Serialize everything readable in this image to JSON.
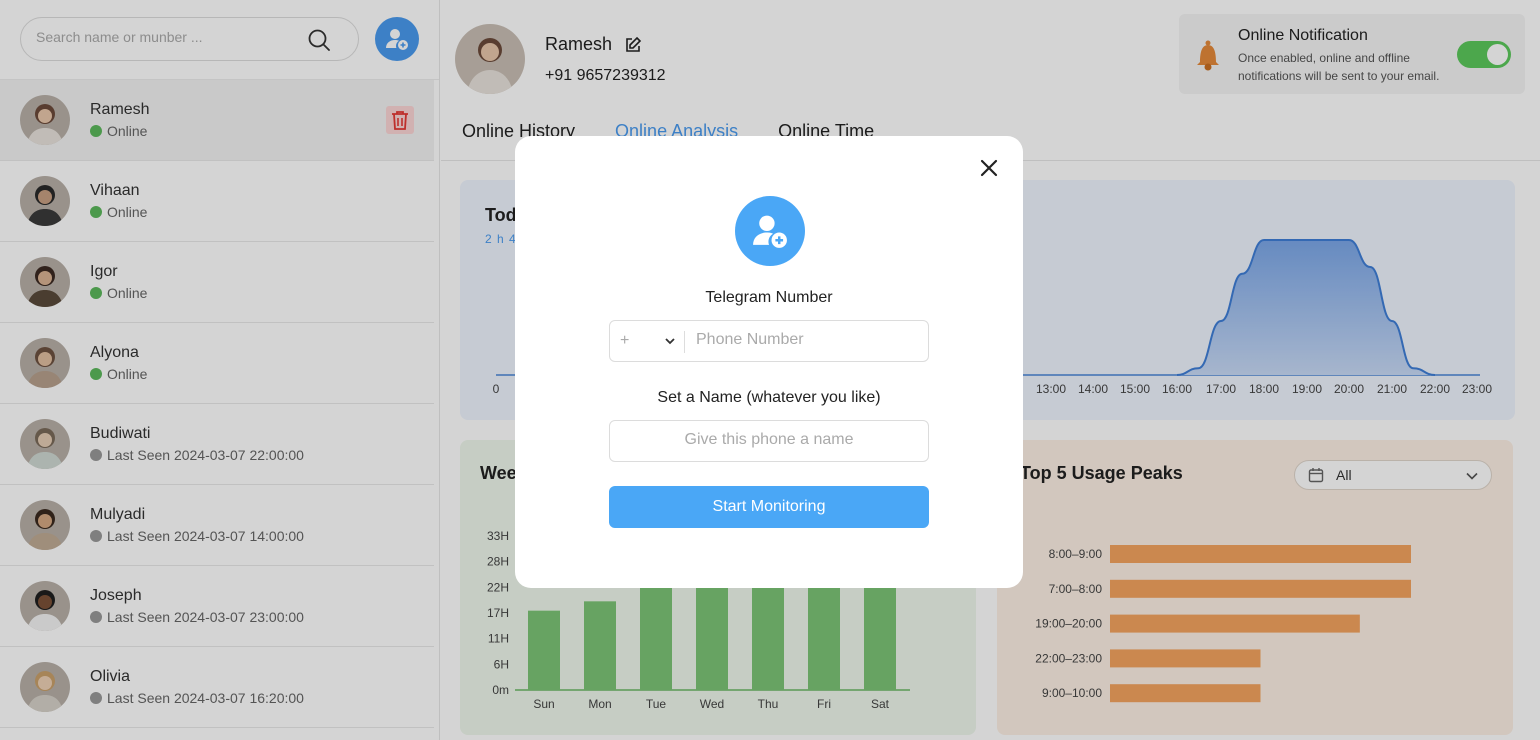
{
  "search": {
    "placeholder": "Search name or munber ..."
  },
  "contacts": [
    {
      "name": "Ramesh",
      "status": "Online",
      "online": true
    },
    {
      "name": "Vihaan",
      "status": "Online",
      "online": true
    },
    {
      "name": "Igor",
      "status": "Online",
      "online": true
    },
    {
      "name": "Alyona",
      "status": "Online",
      "online": true
    },
    {
      "name": "Budiwati",
      "status": "Last Seen 2024-03-07 22:00:00",
      "online": false
    },
    {
      "name": "Mulyadi",
      "status": "Last Seen 2024-03-07 14:00:00",
      "online": false
    },
    {
      "name": "Joseph",
      "status": "Last Seen 2024-03-07 23:00:00",
      "online": false
    },
    {
      "name": "Olivia",
      "status": "Last Seen 2024-03-07 16:20:00",
      "online": false
    }
  ],
  "profile": {
    "name": "Ramesh",
    "phone": "+91 9657239312"
  },
  "notification": {
    "title": "Online Notification",
    "description": "Once enabled, online and offline notifications will be sent to your email.",
    "enabled": true
  },
  "tabs": [
    {
      "label": "Online History"
    },
    {
      "label": "Online Analysis"
    },
    {
      "label": "Online Time"
    }
  ],
  "today_card": {
    "title": "Tod",
    "subtitle": "2 h 4"
  },
  "weekly_card": {
    "title": "Wee"
  },
  "peaks_card": {
    "title": "Top 5 Usage Peaks",
    "filter": "All"
  },
  "chart_data": [
    {
      "type": "area",
      "x_ticks": [
        "0",
        "13:00",
        "14:00",
        "15:00",
        "16:00",
        "17:00",
        "18:00",
        "19:00",
        "20:00",
        "21:00",
        "22:00",
        "23:00"
      ],
      "x": [
        "16:00",
        "16:30",
        "17:00",
        "17:30",
        "18:00",
        "19:00",
        "20:00",
        "20:30",
        "21:00",
        "21:30",
        "22:00"
      ],
      "values": [
        0,
        0.05,
        0.4,
        0.75,
        1,
        1,
        1,
        0.8,
        0.4,
        0.05,
        0
      ]
    },
    {
      "type": "bar",
      "categories": [
        "Sun",
        "Mon",
        "Tue",
        "Wed",
        "Thu",
        "Fri",
        "Sat"
      ],
      "values": [
        17,
        19,
        22,
        22,
        22,
        22,
        22
      ],
      "y_ticks": [
        "0m",
        "6H",
        "11H",
        "17H",
        "22H",
        "28H",
        "33H"
      ],
      "ylim": [
        0,
        33
      ],
      "color": "#7cc576"
    },
    {
      "type": "bar",
      "orientation": "horizontal",
      "categories": [
        "8:00–9:00",
        "7:00–8:00",
        "19:00–20:00",
        "22:00–23:00",
        "9:00–10:00"
      ],
      "values": [
        1.0,
        1.0,
        0.83,
        0.5,
        0.5
      ],
      "color": "#f4a460"
    }
  ],
  "modal": {
    "telegram_label": "Telegram Number",
    "country_code": "+",
    "phone_placeholder": "Phone Number",
    "name_label": "Set a Name (whatever you like)",
    "name_placeholder": "Give this phone a name",
    "start_button": "Start Monitoring"
  },
  "colors": {
    "accent": "#4a9bef",
    "online": "#5cb85c",
    "offline": "#999999",
    "delete": "#e53935"
  }
}
